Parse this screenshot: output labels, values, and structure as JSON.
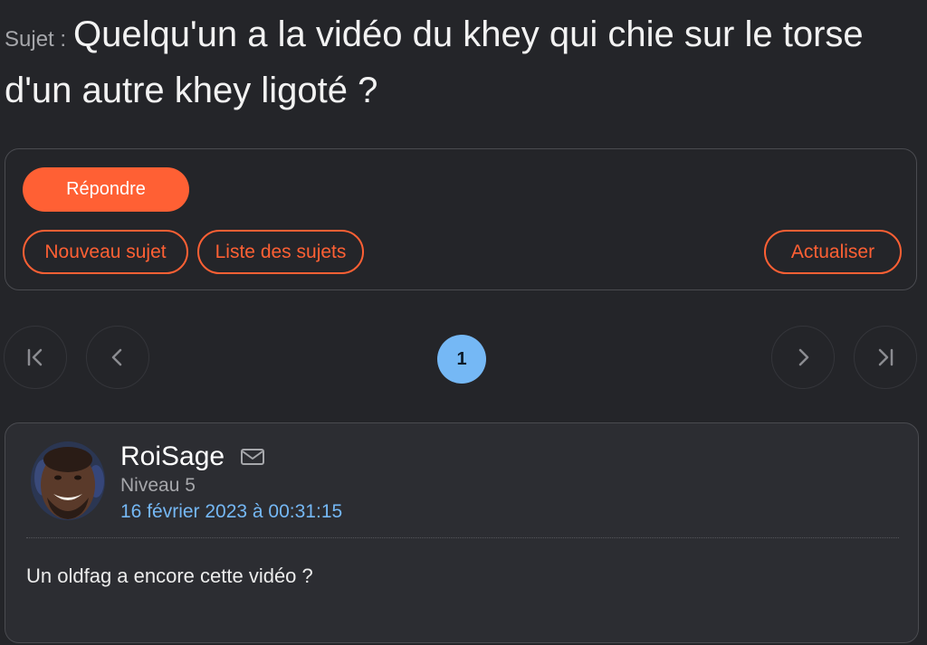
{
  "topic": {
    "prefix": "Sujet :",
    "title": "Quelqu'un a la vidéo du khey qui chie sur le torse d'un autre khey ligoté ?"
  },
  "actions": {
    "reply_label": "Répondre",
    "new_topic_label": "Nouveau sujet",
    "topic_list_label": "Liste des sujets",
    "refresh_label": "Actualiser"
  },
  "pagination": {
    "current_page": "1",
    "icons": [
      "first-page-icon",
      "previous-page-icon",
      "next-page-icon",
      "last-page-icon"
    ]
  },
  "post": {
    "author": "RoiSage",
    "level": "Niveau 5",
    "date": "16 février 2023 à 00:31:15",
    "message": "Un oldfag a encore cette vidéo ?"
  },
  "colors": {
    "background": "#242529",
    "accent": "#ff6034",
    "link_blue": "#75b8f5",
    "card": "#2c2d32",
    "border": "#4a4b50"
  }
}
